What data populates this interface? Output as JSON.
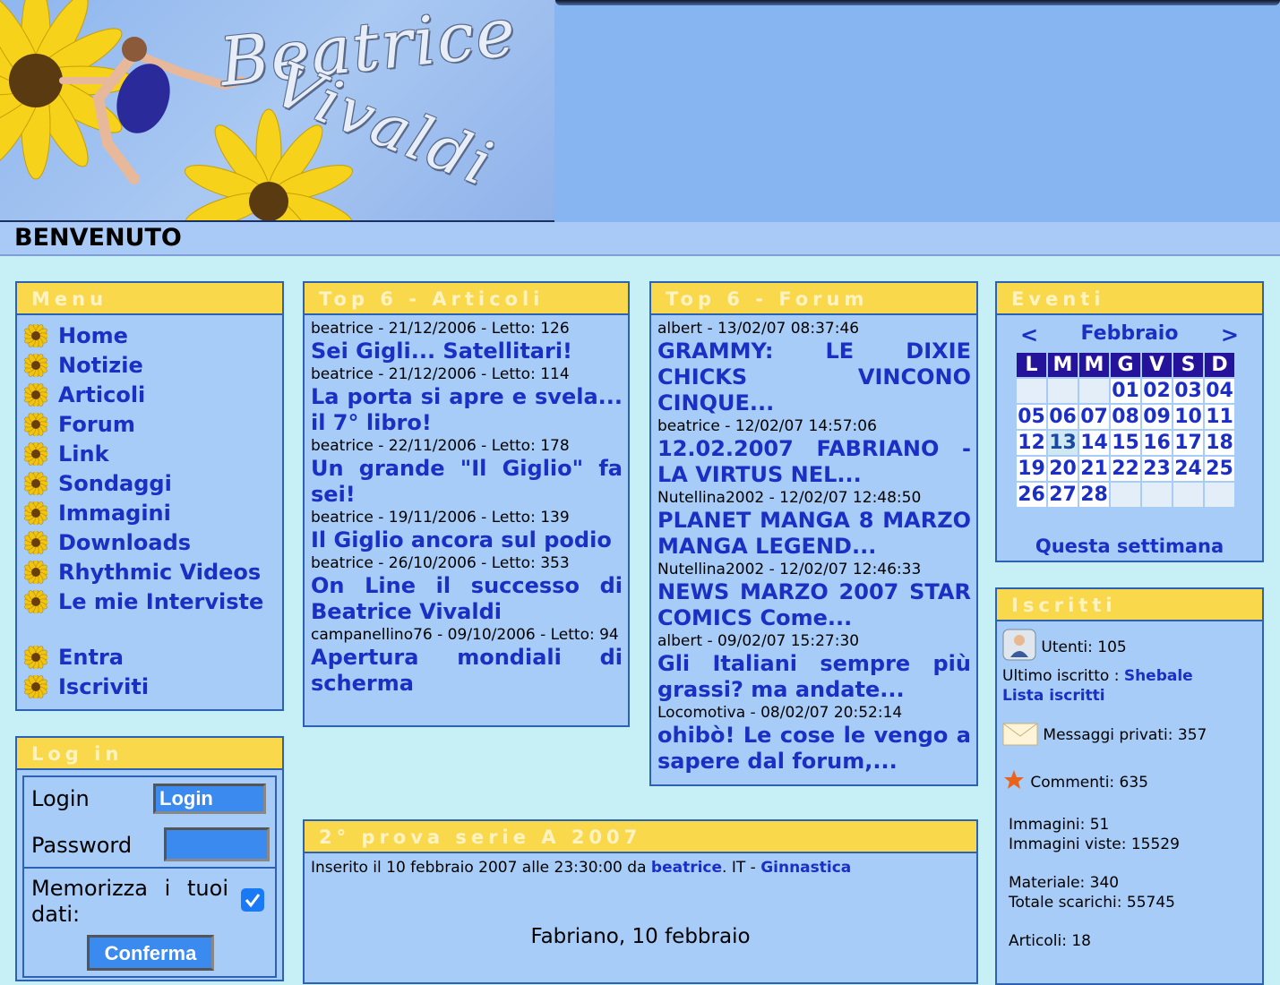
{
  "colors": {
    "link": "#1c2fc4",
    "box_bg": "#a6ccf7",
    "box_border": "#2b62b4",
    "box_header": "#f9d84c",
    "page_bg": "#c6f0f6",
    "calendar_header": "#26139b"
  },
  "banner": {
    "title_line1": "Beatrice",
    "title_line2": "Vivaldi"
  },
  "welcome": "BENVENUTO",
  "menu": {
    "title": "Menu",
    "items": [
      "Home",
      "Notizie",
      "Articoli",
      "Forum",
      "Link",
      "Sondaggi",
      "Immagini",
      "Downloads",
      "Rhythmic Videos",
      "Le mie Interviste"
    ],
    "account_items": [
      "Entra",
      "Iscriviti"
    ],
    "bullet_icon": "sunflower-icon"
  },
  "login": {
    "title": "Log in",
    "login_label": "Login",
    "login_value": "Login",
    "password_label": "Password",
    "remember_label": "Memorizza i tuoi dati:",
    "remember_checked": true,
    "confirm_label": "Conferma"
  },
  "top_articles": {
    "title": "Top 6 - Articoli",
    "items": [
      {
        "meta": "beatrice - 21/12/2006 - Letto: 126",
        "title": "Sei Gigli... Satellitari!"
      },
      {
        "meta": "beatrice - 21/12/2006 - Letto: 114",
        "title": "La porta si apre e svela... il 7° libro!"
      },
      {
        "meta": "beatrice - 22/11/2006 - Letto: 178",
        "title": "Un grande \"Il Giglio\" fa sei!"
      },
      {
        "meta": "beatrice - 19/11/2006 - Letto: 139",
        "title": "Il Giglio ancora sul podio"
      },
      {
        "meta": "beatrice - 26/10/2006 - Letto: 353",
        "title": "On Line il successo di Beatrice Vivaldi"
      },
      {
        "meta": "campanellino76 - 09/10/2006 - Letto: 94",
        "title": "Apertura mondiali di scherma"
      }
    ]
  },
  "top_forum": {
    "title": "Top 6 - Forum",
    "items": [
      {
        "meta": "albert - 13/02/07 08:37:46",
        "title": "GRAMMY: LE DIXIE CHICKS VINCONO CINQUE..."
      },
      {
        "meta": "beatrice - 12/02/07 14:57:06",
        "title": "12.02.2007 FABRIANO - LA VIRTUS NEL..."
      },
      {
        "meta": "Nutellina2002 - 12/02/07 12:48:50",
        "title": "PLANET MANGA 8 MARZO MANGA LEGEND..."
      },
      {
        "meta": "Nutellina2002 - 12/02/07 12:46:33",
        "title": "NEWS MARZO 2007 STAR COMICS Come..."
      },
      {
        "meta": "albert - 09/02/07 15:27:30",
        "title": "Gli Italiani sempre più grassi? ma andate..."
      },
      {
        "meta": "Locomotiva - 08/02/07 20:52:14",
        "title": "ohibò! Le cose le vengo a sapere dal forum,..."
      }
    ]
  },
  "events": {
    "title": "Eventi",
    "prev": "<",
    "next": ">",
    "month": "Febbraio",
    "weekdays": [
      "L",
      "M",
      "M",
      "G",
      "V",
      "S",
      "D"
    ],
    "weeks": [
      [
        "",
        "",
        "",
        "01",
        "02",
        "03",
        "04"
      ],
      [
        "05",
        "06",
        "07",
        "08",
        "09",
        "10",
        "11"
      ],
      [
        "12",
        "13",
        "14",
        "15",
        "16",
        "17",
        "18"
      ],
      [
        "19",
        "20",
        "21",
        "22",
        "23",
        "24",
        "25"
      ],
      [
        "26",
        "27",
        "28",
        "",
        "",
        "",
        ""
      ]
    ],
    "today": "13",
    "week_link": "Questa settimana"
  },
  "members": {
    "title": "Iscritti",
    "users": "Utenti: 105",
    "last_label": "Ultimo iscritto : ",
    "last_user": "Shebale",
    "list_link": "Lista iscritti",
    "messages": "Messaggi privati: 357",
    "comments": "Commenti: 635",
    "images": "Immagini: 51",
    "images_viewed": "Immagini viste: 15529",
    "material": "Materiale: 340",
    "downloads": "Totale scarichi: 55745",
    "articles": "Articoli: 18"
  },
  "news": {
    "title": "2° prova serie A 2007",
    "meta_prefix": "Inserito il 10 febbraio 2007 alle 23:30:00 da ",
    "author": "beatrice",
    "meta_mid": ". IT - ",
    "category": "Ginnastica",
    "body": "Fabriano, 10 febbraio"
  }
}
